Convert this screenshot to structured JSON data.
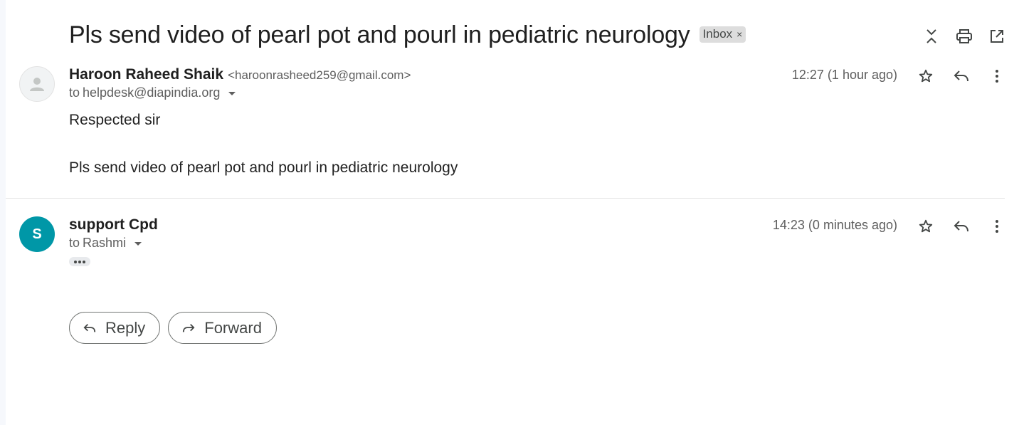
{
  "thread": {
    "subject": "Pls send video of pearl pot and pourl in pediatric neurology",
    "label": "Inbox",
    "label_remove": "×"
  },
  "top_actions": {
    "icons": [
      "collapse-expand-icon",
      "print-icon",
      "open-in-new-window-icon"
    ]
  },
  "messages": [
    {
      "sender_name": "Haroon Raheed Shaik",
      "sender_email": "<haroonrasheed259@gmail.com>",
      "to_prefix": "to",
      "to": "helpdesk@diapindia.org",
      "time": "12:27 (1 hour ago)",
      "body": [
        "Respected sir",
        "Pls send video of pearl pot and pourl in pediatric neurology"
      ],
      "avatar": "default-person"
    },
    {
      "sender_name": "support Cpd",
      "to_prefix": "to",
      "to": "Rashmi",
      "time": "14:23 (0 minutes ago)",
      "avatar_letter": "S",
      "avatar_color": "#0097a7"
    }
  ],
  "reply_bar": {
    "reply_label": "Reply",
    "forward_label": "Forward"
  }
}
